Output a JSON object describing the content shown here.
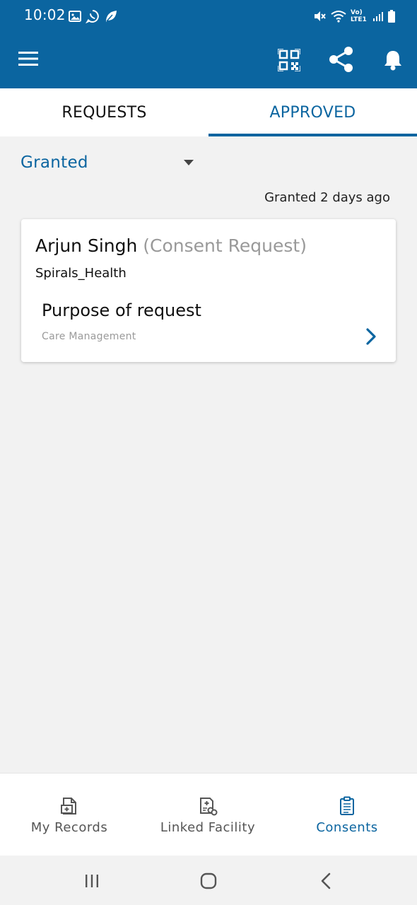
{
  "status_bar": {
    "time": "10:02",
    "network_label": "Vo) LTE1",
    "icons": [
      "gallery-icon",
      "whatsapp-icon",
      "leaf-icon",
      "mute-icon",
      "wifi-icon",
      "signal-icon",
      "battery-icon"
    ]
  },
  "app_bar": {
    "icons": [
      "menu-icon",
      "qr-code-icon",
      "share-icon",
      "bell-icon"
    ],
    "color": "#0b65a0"
  },
  "tabs": [
    {
      "label": "REQUESTS",
      "active": false
    },
    {
      "label": "APPROVED",
      "active": true
    }
  ],
  "filter": {
    "selected": "Granted"
  },
  "granted_time": "Granted 2 days ago",
  "consent_card": {
    "name": "Arjun Singh",
    "type": "(Consent Request)",
    "organization": "Spirals_Health",
    "purpose_label": "Purpose of request",
    "purpose_value": "Care Management"
  },
  "bottom_nav": [
    {
      "label": "My Records",
      "icon": "records-icon",
      "active": false
    },
    {
      "label": "Linked Facility",
      "icon": "linked-facility-icon",
      "active": false
    },
    {
      "label": "Consents",
      "icon": "consents-icon",
      "active": true
    }
  ],
  "system_nav": [
    "recents-button",
    "home-button",
    "back-button"
  ]
}
